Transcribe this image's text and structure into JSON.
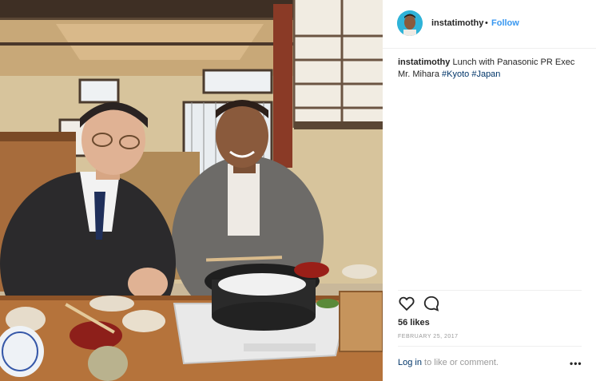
{
  "post": {
    "author": {
      "username": "instatimothy",
      "separator": "•",
      "follow_label": "Follow"
    },
    "caption": {
      "username": "instatimothy",
      "text": " Lunch with Panasonic PR Exec Mr. Mihara ",
      "hashtags": [
        "#Kyoto",
        "#Japan"
      ]
    },
    "likes": "56 likes",
    "date": "FEBRUARY 25, 2017",
    "comment_prompt": {
      "login_label": "Log in",
      "rest": " to like or comment."
    },
    "more_label": "•••",
    "icons": {
      "like": "heart-icon",
      "comment": "comment-bubble-icon",
      "more": "more-options-icon"
    },
    "colors": {
      "link_blue": "#3897f0",
      "hashtag": "#003569",
      "muted": "#999999",
      "avatar_bg": "#2fb3d8"
    }
  }
}
